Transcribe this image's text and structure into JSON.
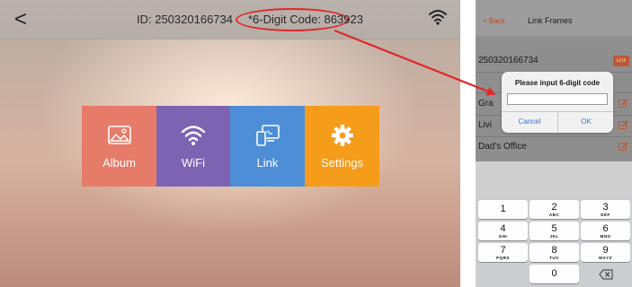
{
  "tablet": {
    "back_icon": "chevron-left-icon",
    "back_glyph": "<",
    "device_id": "ID: 250320166734",
    "digit_code": "*6-Digit Code: 863923",
    "wifi_icon": "wifi-icon",
    "highlight_color": "#e02828",
    "tiles": [
      {
        "label": "Album",
        "icon": "image-icon",
        "color": "#e77b6a"
      },
      {
        "label": "WiFi",
        "icon": "wifi-icon",
        "color": "#7d64b3"
      },
      {
        "label": "Link",
        "icon": "link-devices-icon",
        "color": "#4e8ed6"
      },
      {
        "label": "Settings",
        "icon": "gear-icon",
        "color": "#f59c1b"
      }
    ]
  },
  "phone": {
    "back_label": "< Back",
    "title": "Link Frames",
    "frame_id": "250320166734",
    "link_label": "Link",
    "frames": [
      {
        "name": "Gra",
        "edit_icon": "edit-icon"
      },
      {
        "name": "Livi",
        "edit_icon": "edit-icon"
      },
      {
        "name": "Dad's Office",
        "edit_icon": "edit-icon"
      }
    ],
    "dialog": {
      "title": "Please input 6-digit code",
      "input_value": "",
      "cancel_label": "Cancel",
      "ok_label": "OK"
    },
    "keypad": [
      {
        "num": "1",
        "letters": ""
      },
      {
        "num": "2",
        "letters": "ABC"
      },
      {
        "num": "3",
        "letters": "DEF"
      },
      {
        "num": "4",
        "letters": "GHI"
      },
      {
        "num": "5",
        "letters": "JKL"
      },
      {
        "num": "6",
        "letters": "MNO"
      },
      {
        "num": "7",
        "letters": "PQRS"
      },
      {
        "num": "8",
        "letters": "TUV"
      },
      {
        "num": "9",
        "letters": "WXYZ"
      },
      {
        "num": "0",
        "letters": ""
      }
    ],
    "delete_icon": "backspace-icon",
    "accent_color": "#bb5a35"
  }
}
